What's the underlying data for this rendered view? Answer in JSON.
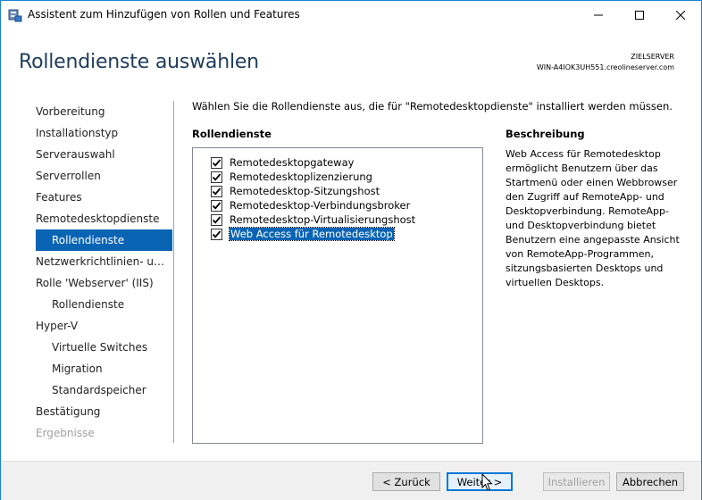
{
  "window": {
    "title": "Assistent zum Hinzufügen von Rollen und Features",
    "icons": [
      "server-manager-icon",
      "minimize-icon",
      "maximize-icon",
      "close-icon"
    ]
  },
  "header": {
    "page_title": "Rollendienste auswählen",
    "server_label": "ZIELSERVER",
    "server_name": "WIN-A4IOK3UH551.creolineserver.com"
  },
  "nav": {
    "items": [
      {
        "label": "Vorbereitung",
        "state": "normal"
      },
      {
        "label": "Installationstyp",
        "state": "normal"
      },
      {
        "label": "Serverauswahl",
        "state": "normal"
      },
      {
        "label": "Serverrollen",
        "state": "normal"
      },
      {
        "label": "Features",
        "state": "normal"
      },
      {
        "label": "Remotedesktopdienste",
        "state": "normal"
      },
      {
        "label": "Rollendienste",
        "state": "active"
      },
      {
        "label": "Netzwerkrichtlinien- und...",
        "state": "normal"
      },
      {
        "label": "Rolle 'Webserver' (IIS)",
        "state": "normal"
      },
      {
        "label": "Rollendienste",
        "state": "sub"
      },
      {
        "label": "Hyper-V",
        "state": "normal"
      },
      {
        "label": "Virtuelle Switches",
        "state": "sub"
      },
      {
        "label": "Migration",
        "state": "sub"
      },
      {
        "label": "Standardspeicher",
        "state": "sub"
      },
      {
        "label": "Bestätigung",
        "state": "normal"
      },
      {
        "label": "Ergebnisse",
        "state": "disabled"
      }
    ]
  },
  "main": {
    "instruction": "Wählen Sie die Rollendienste aus, die für \"Remotedesktopdienste\" installiert werden müssen.",
    "list_heading": "Rollendienste",
    "role_services": [
      {
        "label": "Remotedesktopgateway",
        "checked": true,
        "selected": false
      },
      {
        "label": "Remotedesktoplizenzierung",
        "checked": true,
        "selected": false
      },
      {
        "label": "Remotedesktop-Sitzungshost",
        "checked": true,
        "selected": false
      },
      {
        "label": "Remotedesktop-Verbindungsbroker",
        "checked": true,
        "selected": false
      },
      {
        "label": "Remotedesktop-Virtualisierungshost",
        "checked": true,
        "selected": false
      },
      {
        "label": "Web Access für Remotedesktop",
        "checked": true,
        "selected": true
      }
    ],
    "description_heading": "Beschreibung",
    "description_text": "Web Access für Remotedesktop ermöglicht Benutzern über das Startmenü oder einen Webbrowser den Zugriff auf RemoteApp- und Desktopverbindung. RemoteApp- und Desktopverbindung bietet Benutzern eine angepasste Ansicht von RemoteApp-Programmen, sitzungsbasierten Desktops und virtuellen Desktops."
  },
  "footer": {
    "back_label": "< Zurück",
    "next_label": "Weiter >",
    "install_label": "Installieren",
    "cancel_label": "Abbrechen"
  },
  "colors": {
    "accent": "#0a64b4",
    "title_color": "#1e3c5a",
    "window_border": "#1883d7"
  }
}
